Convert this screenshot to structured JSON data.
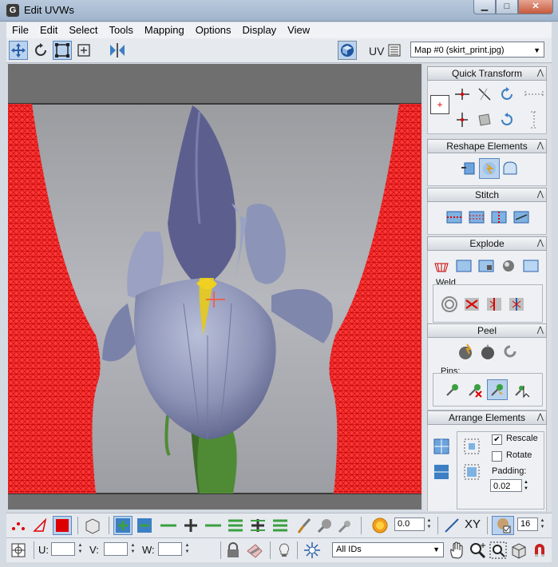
{
  "window": {
    "title": "Edit UVWs",
    "app_icon_letter": "G"
  },
  "menu": [
    "File",
    "Edit",
    "Select",
    "Tools",
    "Mapping",
    "Options",
    "Display",
    "View"
  ],
  "toolbar": {
    "tools": [
      "move-icon",
      "rotate-icon",
      "scale-icon",
      "freeform-icon",
      "mirror-icon"
    ],
    "uv_label": "UV",
    "map_selected": "Map #0 (skirt_print.jpg)"
  },
  "panels": {
    "quick_transform": {
      "title": "Quick Transform"
    },
    "reshape": {
      "title": "Reshape Elements"
    },
    "stitch": {
      "title": "Stitch"
    },
    "explode": {
      "title": "Explode",
      "weld_label": "Weld"
    },
    "peel": {
      "title": "Peel",
      "pins_label": "Pins:"
    },
    "arrange": {
      "title": "Arrange Elements",
      "rescale_label": "Rescale",
      "rescale_checked": true,
      "rotate_label": "Rotate",
      "rotate_checked": false,
      "padding_label": "Padding:",
      "padding_value": "0.02"
    }
  },
  "bottom1": {
    "soft_value": "0.0",
    "xy_label": "XY",
    "grid_value": "16"
  },
  "bottom2": {
    "u_label": "U:",
    "v_label": "V:",
    "w_label": "W:",
    "u_value": "",
    "v_value": "",
    "w_value": "",
    "ids_selected": "All IDs"
  },
  "colors": {
    "mesh": "#ff1a1a",
    "accent_blue": "#3c7fc4",
    "green_tool": "#3aa040"
  }
}
